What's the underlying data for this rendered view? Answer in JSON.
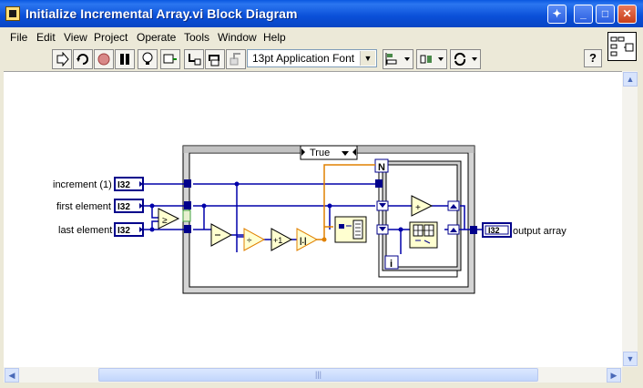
{
  "window": {
    "title": "Initialize Incremental Array.vi Block Diagram"
  },
  "menubar": {
    "items": [
      {
        "label": "File"
      },
      {
        "label": "Edit"
      },
      {
        "label": "View"
      },
      {
        "label": "Project"
      },
      {
        "label": "Operate"
      },
      {
        "label": "Tools"
      },
      {
        "label": "Window"
      },
      {
        "label": "Help"
      }
    ]
  },
  "toolbar": {
    "font_select": "13pt Application Font",
    "help_label": "?"
  },
  "diagram": {
    "case_selector": "True",
    "controls": {
      "increment": "increment (1)",
      "first_element": "first element",
      "last_element": "last element",
      "dtype": "I32"
    },
    "indicator": {
      "label": "output array",
      "dtype": "I32"
    },
    "loop_count": "N",
    "loop_index": "i"
  }
}
